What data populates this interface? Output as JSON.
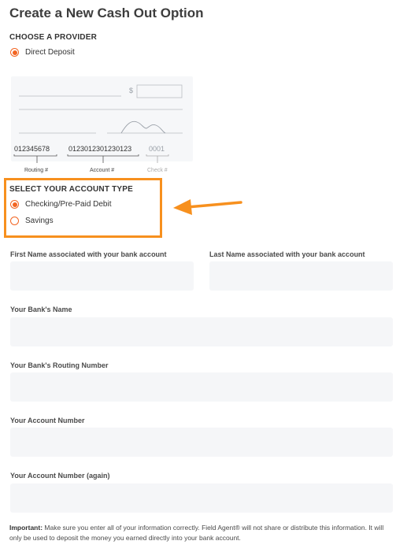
{
  "page": {
    "title": "Create a New Cash Out Option"
  },
  "provider": {
    "heading": "CHOOSE A PROVIDER",
    "options": [
      {
        "label": "Direct Deposit",
        "selected": true
      }
    ]
  },
  "check_image": {
    "routing_number": "012345678",
    "account_number": "0123012301230123",
    "check_number": "0001",
    "routing_caption": "Routing #",
    "account_caption": "Account #",
    "check_caption": "Check #",
    "dollar_sign": "$"
  },
  "account_type": {
    "heading": "SELECT YOUR ACCOUNT TYPE",
    "options": [
      {
        "label": "Checking/Pre-Paid Debit",
        "selected": true
      },
      {
        "label": "Savings",
        "selected": false
      }
    ]
  },
  "form": {
    "first_name": {
      "label": "First Name associated with your bank account",
      "value": ""
    },
    "last_name": {
      "label": "Last Name associated with your bank account",
      "value": ""
    },
    "bank_name": {
      "label": "Your Bank's Name",
      "value": ""
    },
    "routing_number": {
      "label": "Your Bank's Routing Number",
      "value": ""
    },
    "account_number": {
      "label": "Your Account Number",
      "value": ""
    },
    "account_number_again": {
      "label": "Your Account Number (again)",
      "value": ""
    }
  },
  "note": {
    "prefix": "Important:",
    "text": " Make sure you enter all of your information correctly. Field Agent® will not share or distribute this information. It will only be used to deposit the money you earned directly into your bank account."
  },
  "colors": {
    "accent": "#f26522",
    "highlight": "#f7901e",
    "input_bg": "#f5f6f8"
  }
}
